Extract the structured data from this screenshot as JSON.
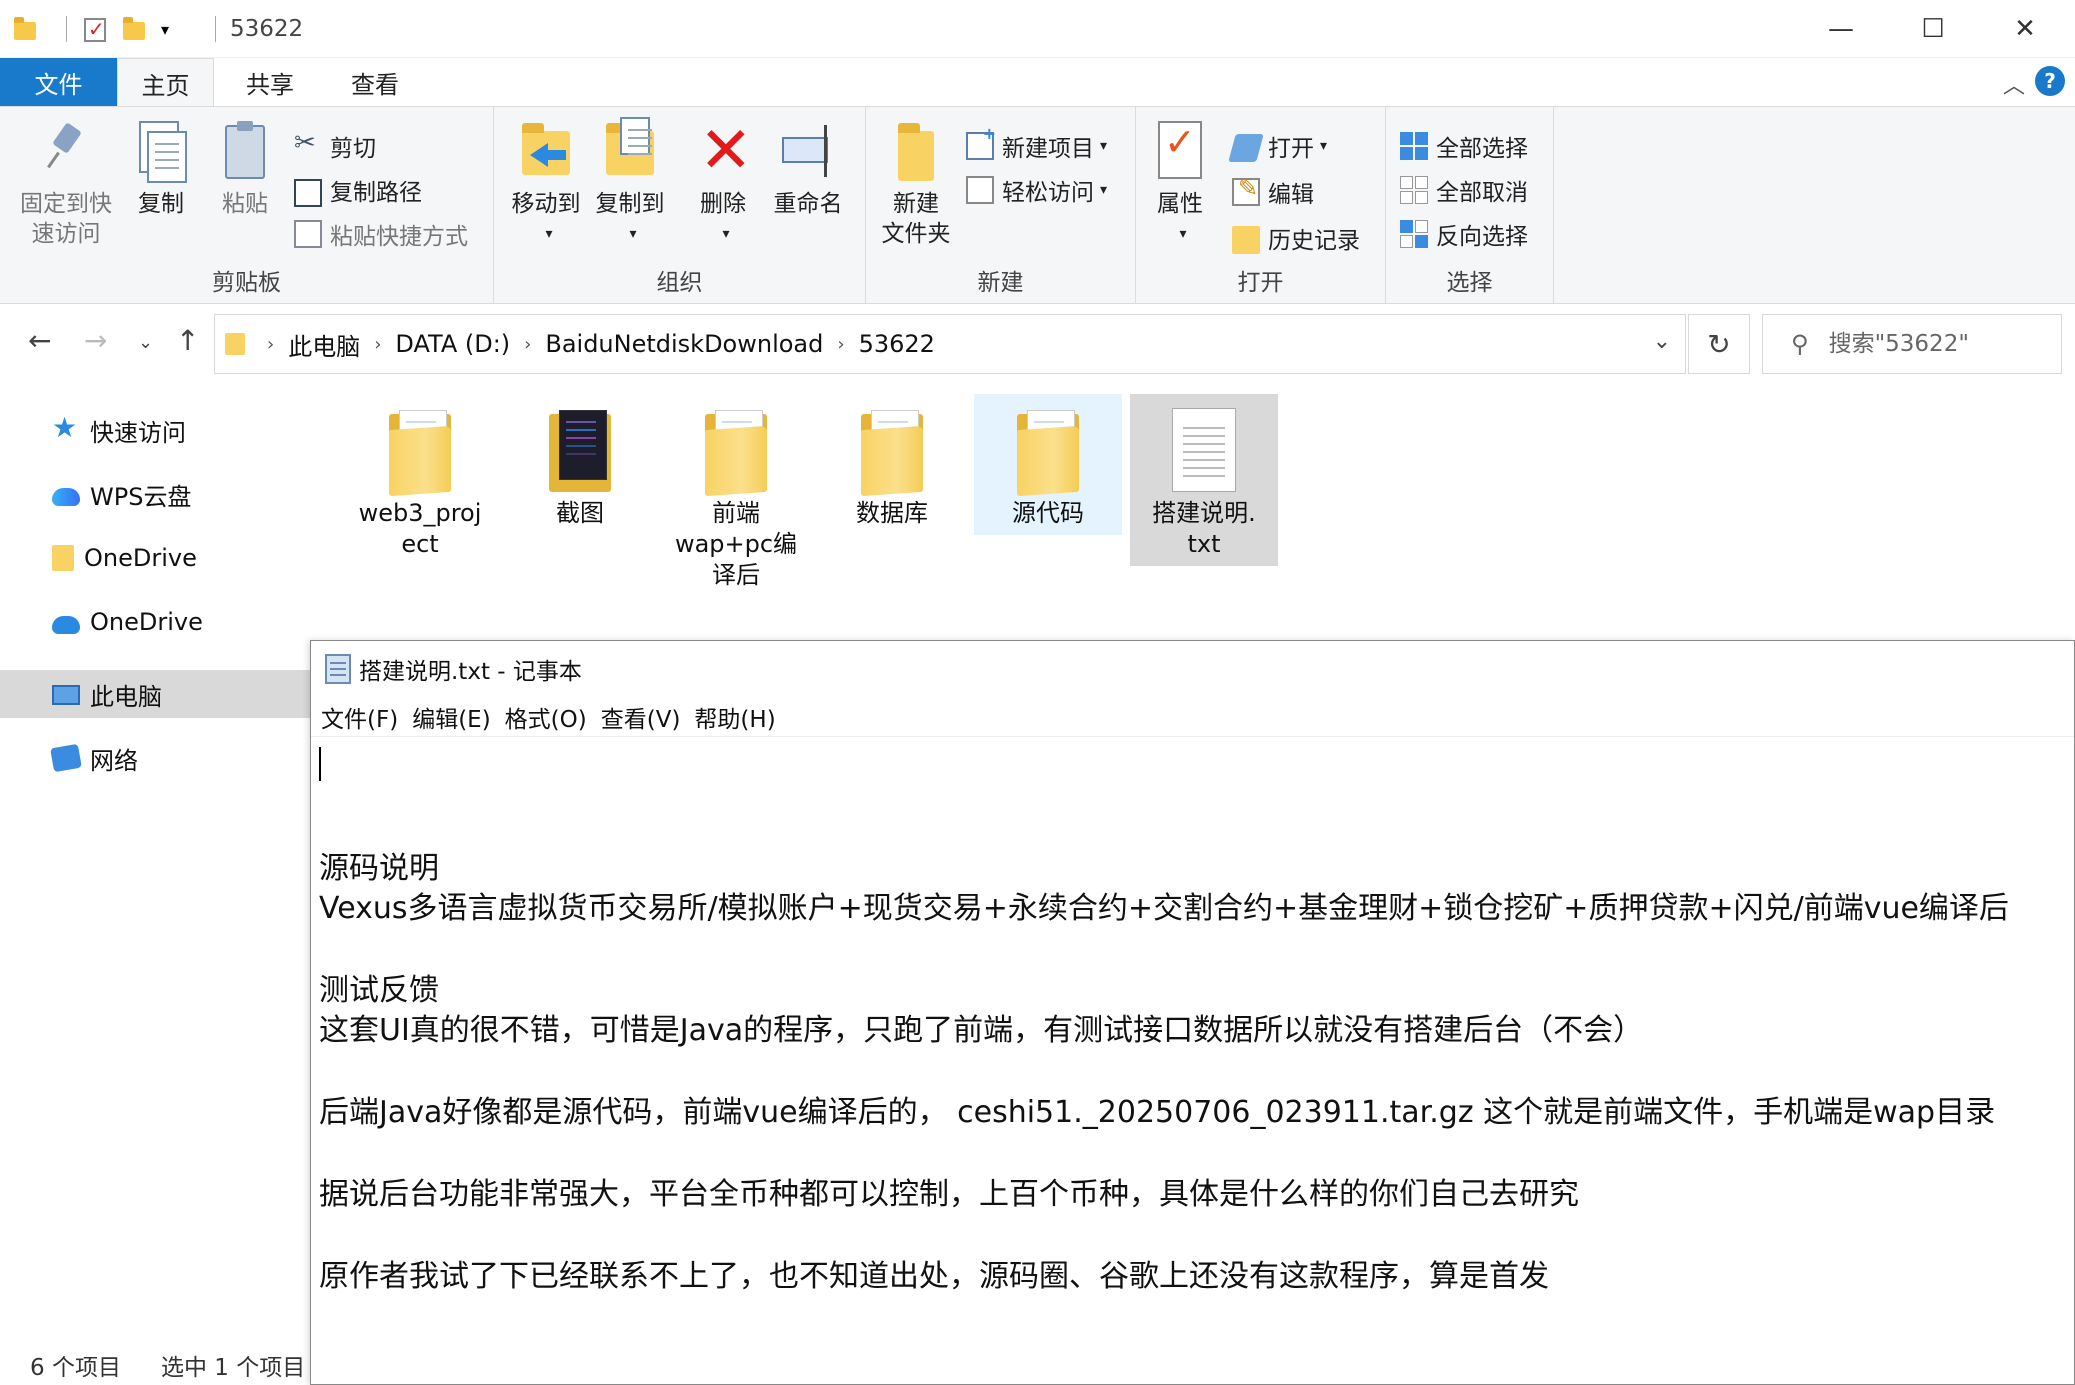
{
  "explorer": {
    "title": "53622",
    "window_controls": {
      "minimize": "—",
      "maximize": "☐",
      "close": "✕"
    },
    "tabs": [
      {
        "label": "文件"
      },
      {
        "label": "主页"
      },
      {
        "label": "共享"
      },
      {
        "label": "查看"
      }
    ],
    "help": "?",
    "ribbon": {
      "clipboard": {
        "group_label": "剪贴板",
        "pin_line1": "固定到快",
        "pin_line2": "速访问",
        "copy": "复制",
        "paste": "粘贴",
        "cut": "剪切",
        "copy_path": "复制路径",
        "paste_shortcut": "粘贴快捷方式"
      },
      "organize": {
        "group_label": "组织",
        "move_to": "移动到",
        "copy_to": "复制到",
        "delete": "删除",
        "rename": "重命名"
      },
      "new": {
        "group_label": "新建",
        "new_folder_line1": "新建",
        "new_folder_line2": "文件夹",
        "new_item": "新建项目",
        "easy_access": "轻松访问"
      },
      "open": {
        "group_label": "打开",
        "properties": "属性",
        "open": "打开",
        "edit": "编辑",
        "history": "历史记录"
      },
      "select": {
        "group_label": "选择",
        "select_all": "全部选择",
        "select_none": "全部取消",
        "invert": "反向选择"
      }
    },
    "address": {
      "crumbs": [
        "此电脑",
        "DATA (D:)",
        "BaiduNetdiskDownload",
        "53622"
      ]
    },
    "search": {
      "placeholder": "搜索\"53622\""
    },
    "nav_pane": [
      {
        "label": "快速访问",
        "icon": "star-icon"
      },
      {
        "label": "WPS云盘",
        "icon": "wps-cloud-icon"
      },
      {
        "label": "OneDrive",
        "icon": "folder-icon"
      },
      {
        "label": "OneDrive",
        "icon": "onedrive-cloud-icon"
      },
      {
        "label": "此电脑",
        "icon": "pc-icon"
      },
      {
        "label": "网络",
        "icon": "network-icon"
      }
    ],
    "files": [
      {
        "name_line1": "web3_proj",
        "name_line2": "ect",
        "name_line3": "",
        "type": "folder"
      },
      {
        "name_line1": "截图",
        "name_line2": "",
        "name_line3": "",
        "type": "folder-dark"
      },
      {
        "name_line1": "前端",
        "name_line2": "wap+pc编",
        "name_line3": "译后",
        "type": "folder"
      },
      {
        "name_line1": "数据库",
        "name_line2": "",
        "name_line3": "",
        "type": "folder"
      },
      {
        "name_line1": "源代码",
        "name_line2": "",
        "name_line3": "",
        "type": "folder"
      },
      {
        "name_line1": "搭建说明.",
        "name_line2": "txt",
        "name_line3": "",
        "type": "txt"
      }
    ],
    "status": {
      "count": "6 个项目",
      "selected": "选中 1 个项目"
    }
  },
  "notepad": {
    "title": "搭建说明.txt - 记事本",
    "menu": [
      "文件(F)",
      "编辑(E)",
      "格式(O)",
      "查看(V)",
      "帮助(H)"
    ],
    "lines": [
      "源码说明",
      "Vexus多语言虚拟货币交易所/模拟账户+现货交易+永续合约+交割合约+基金理财+锁仓挖矿+质押贷款+闪兑/前端vue编译后",
      "测试反馈",
      "这套UI真的很不错，可惜是Java的程序，只跑了前端，有测试接口数据所以就没有搭建后台（不会）",
      "后端Java好像都是源代码，前端vue编译后的， ceshi51._20250706_023911.tar.gz 这个就是前端文件，手机端是wap目录",
      "据说后台功能非常强大，平台全币种都可以控制，上百个币种，具体是什么样的你们自己去研究",
      "原作者我试了下已经联系不上了，也不知道出处，源码圈、谷歌上还没有这款程序，算是首发"
    ]
  },
  "colors": {
    "accent": "#1979ca",
    "folder": "#f8d263",
    "hover": "#e5f3ff",
    "selected": "#d9d9d9",
    "delete_red": "#e21a1a"
  }
}
